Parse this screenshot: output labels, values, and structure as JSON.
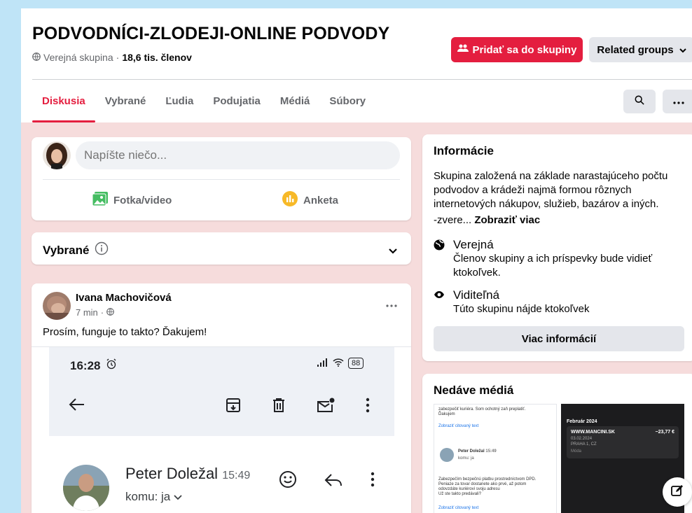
{
  "group": {
    "title": "PODVODNÍCI-ZLODEJI-ONLINE PODVODY",
    "privacy": "Verejná skupina",
    "separator": "·",
    "members": "18,6 tis. členov"
  },
  "header": {
    "join_label": "Pridať sa do skupiny",
    "related_label": "Related groups"
  },
  "tabs": [
    {
      "label": "Diskusia",
      "active": true
    },
    {
      "label": "Vybrané"
    },
    {
      "label": "Ľudia"
    },
    {
      "label": "Podujatia"
    },
    {
      "label": "Médiá"
    },
    {
      "label": "Súbory"
    }
  ],
  "composer": {
    "placeholder": "Napíšte niečo...",
    "photo_label": "Fotka/video",
    "poll_label": "Anketa"
  },
  "featured": {
    "label": "Vybrané"
  },
  "post": {
    "author": "Ivana Machovičová",
    "time": "7 min",
    "separator": "·",
    "text": "Prosím, funguje to takto? Ďakujem!",
    "screenshot": {
      "clock": "16:28",
      "battery": "88",
      "sender_name": "Peter Doležal",
      "sender_time": "15:49",
      "to": "komu: ja"
    }
  },
  "info": {
    "heading": "Informácie",
    "description": "Skupina založená na základe narastajúceho počtu podvodov a krádeži najmä formou rôznych internetových nákupov, služieb, bazárov a iných.",
    "more_prefix": "-zvere...",
    "more_link": "Zobraziť viac",
    "public_title": "Verejná",
    "public_desc": "Členov skupiny a ich príspevky bude vidieť ktokoľvek.",
    "visible_title": "Viditeľná",
    "visible_desc": "Túto skupinu nájde ktokoľvek",
    "button": "Viac informácií"
  },
  "media": {
    "heading": "Nedáve médiá",
    "thumb1": {
      "line1": "zabezpečiť kuriéra. Som ochotný zaň preplatiť.",
      "line2": "Ďakujem",
      "link1": "Zobraziť citovaný text",
      "sender": "Peter Doležal",
      "sender_time": "15:49",
      "to": "komu: ja",
      "body1": "Zabezpečím bezpečnú platbu prostredníctvom DPD.",
      "body2": "Peniaze za tovar dostanete ako prvé, až potom",
      "body3": "odovzdáte kuriérovi svoju adresu",
      "body4": "Už ste takto predávali?",
      "link2": "Zobraziť citovaný text"
    },
    "thumb2": {
      "month": "Február 2024",
      "merchant": "WWW.MANCINI.SK",
      "amount": "−23,77 €",
      "date": "03.02.2024",
      "city": "PRAHA 1, CZ",
      "tag": "Móda"
    }
  },
  "colors": {
    "accent": "#e41e3f",
    "background": "#f6dcdc",
    "outer": "#bfe4f7"
  }
}
